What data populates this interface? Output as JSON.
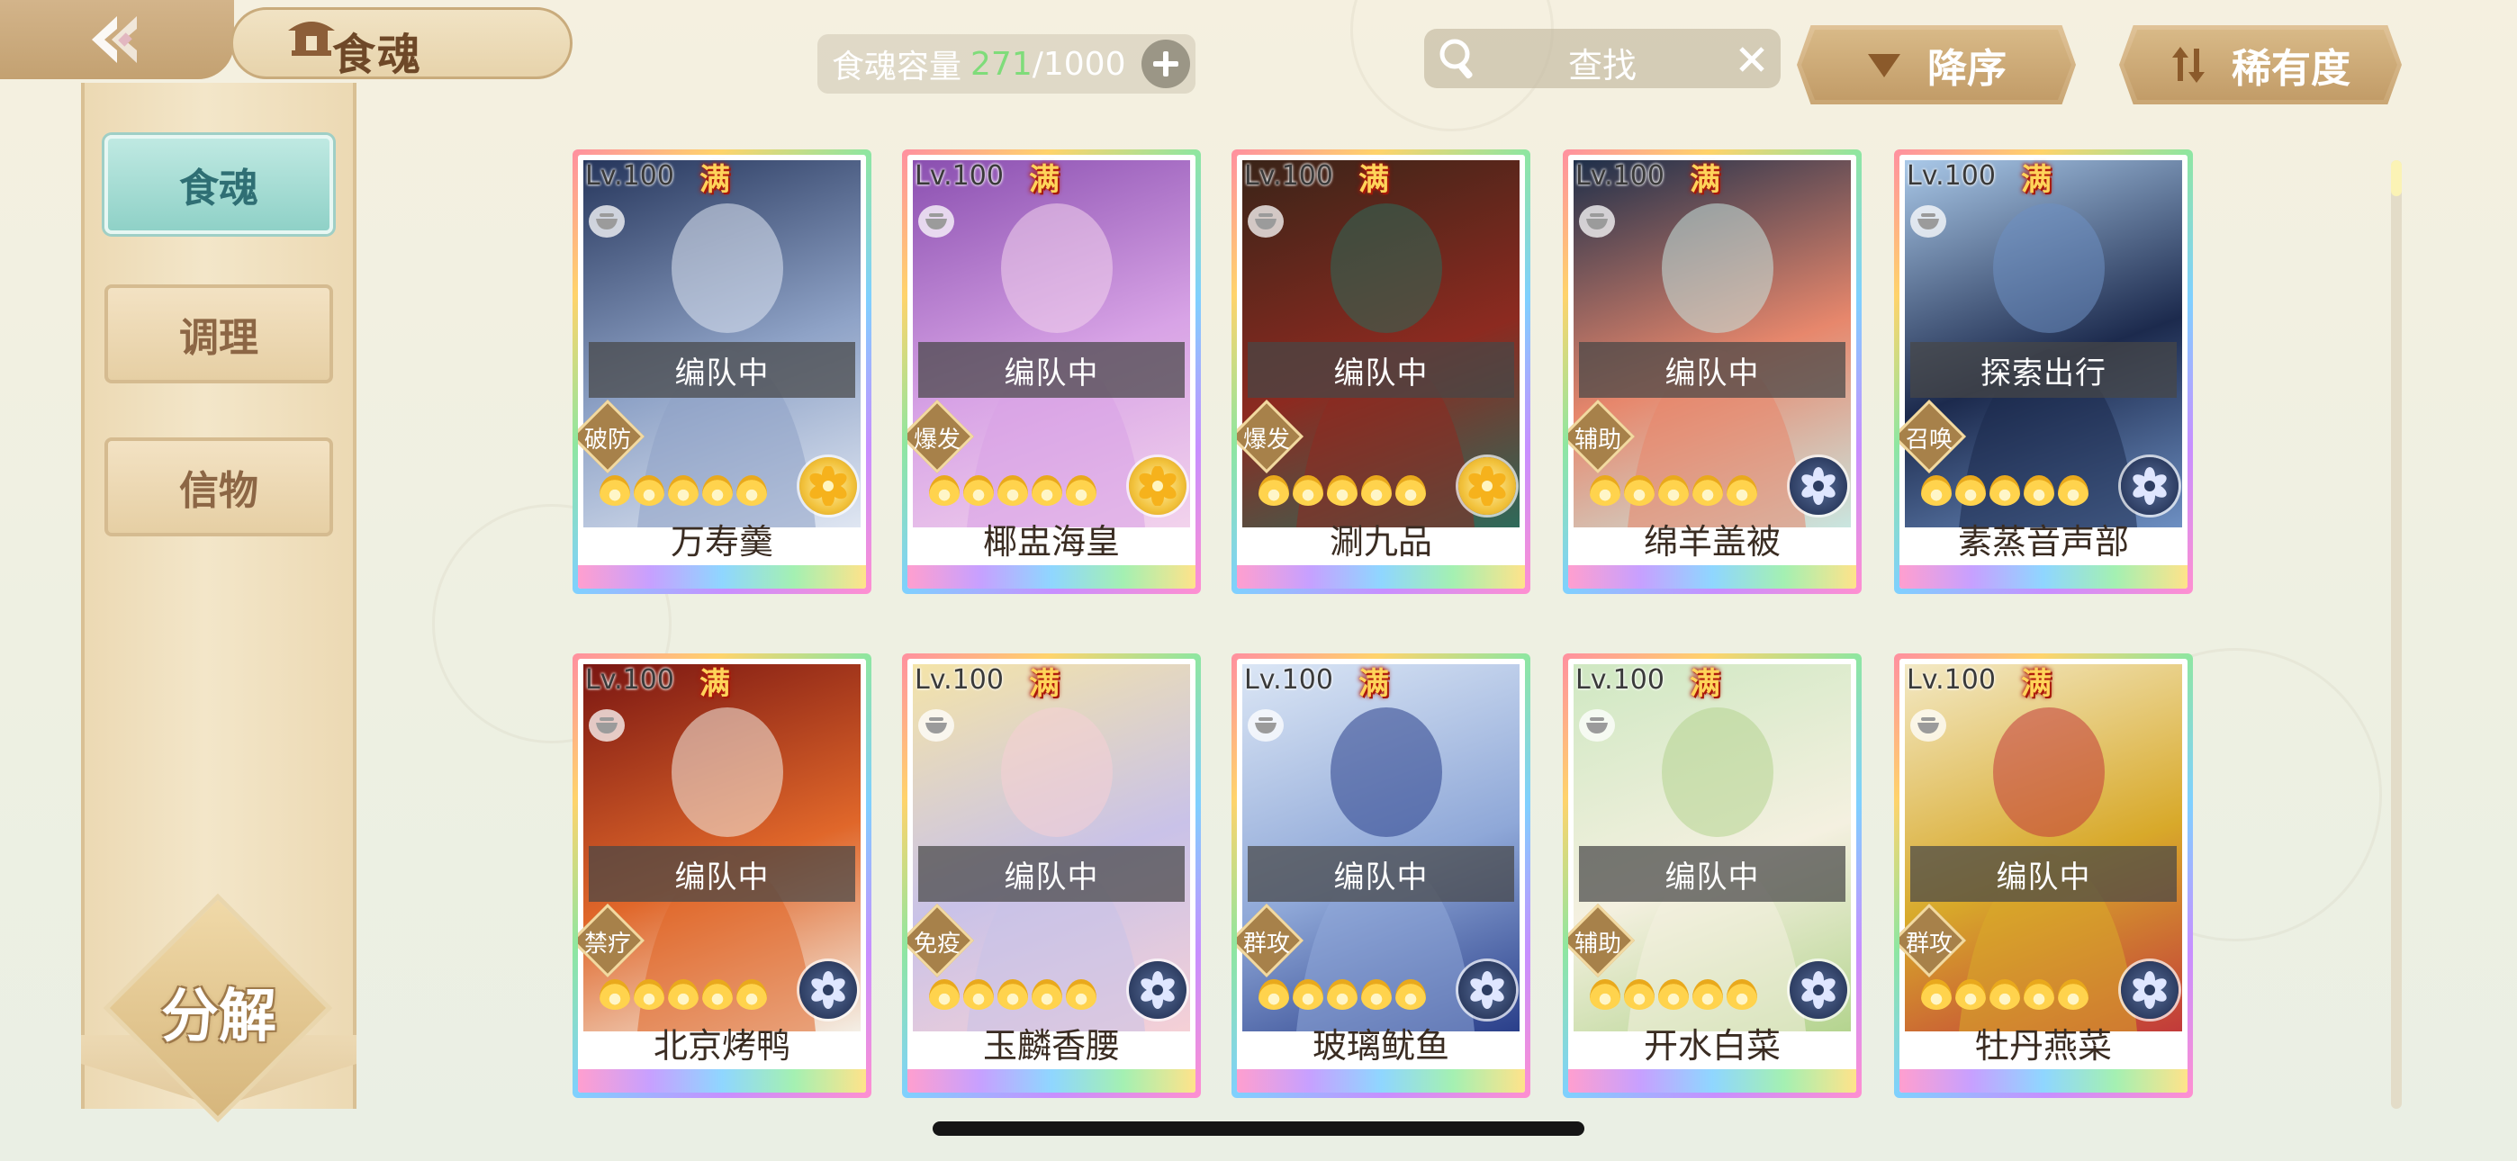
{
  "header": {
    "title": "食魂",
    "back_icon": "back-arrow-icon",
    "home_icon": "pavilion-icon"
  },
  "capacity": {
    "label": "食魂容量",
    "used": "271",
    "separator": "/",
    "total": "1000",
    "used_color": "#7fdc7a"
  },
  "search": {
    "label": "查找"
  },
  "sort": {
    "order_label": "降序",
    "rarity_label": "稀有度"
  },
  "sidebar": {
    "items": [
      {
        "label": "食魂",
        "active": true
      },
      {
        "label": "调理",
        "active": false
      },
      {
        "label": "信物",
        "active": false
      }
    ],
    "decompose_label": "分解"
  },
  "cards": [
    {
      "level": "Lv.100",
      "full": "满",
      "status": "编队中",
      "role": "破防",
      "stars": 5,
      "badge": "gold",
      "name": "万寿羹",
      "palette": [
        "#26365c",
        "#8fa3c7",
        "#dfe6f2"
      ]
    },
    {
      "level": "Lv.100",
      "full": "满",
      "status": "编队中",
      "role": "爆发",
      "stars": 5,
      "badge": "gold",
      "name": "椰盅海皇",
      "palette": [
        "#8a4fb0",
        "#d8a3e6",
        "#f2d3ec"
      ]
    },
    {
      "level": "Lv.100",
      "full": "满",
      "status": "编队中",
      "role": "爆发",
      "stars": 5,
      "badge": "gold",
      "name": "涮九品",
      "palette": [
        "#3a2418",
        "#8c2a20",
        "#2e6a5a"
      ]
    },
    {
      "level": "Lv.100",
      "full": "满",
      "status": "编队中",
      "role": "辅助",
      "stars": 5,
      "badge": "navy",
      "name": "绵羊盖被",
      "palette": [
        "#1e2f4a",
        "#e7876c",
        "#c9e6e0"
      ]
    },
    {
      "level": "Lv.100",
      "full": "满",
      "status": "探索出行",
      "role": "召唤",
      "stars": 5,
      "badge": "navy",
      "name": "素蒸音声部",
      "palette": [
        "#a9c8e8",
        "#1c2a4d",
        "#6d8fc2"
      ]
    },
    {
      "level": "Lv.100",
      "full": "满",
      "status": "编队中",
      "role": "禁疗",
      "stars": 5,
      "badge": "navy",
      "name": "北京烤鸭",
      "palette": [
        "#7a1612",
        "#e0672a",
        "#f4efe6"
      ]
    },
    {
      "level": "Lv.100",
      "full": "满",
      "status": "编队中",
      "role": "免疫",
      "stars": 5,
      "badge": "navy",
      "name": "玉麟香腰",
      "palette": [
        "#f4e4a8",
        "#c9c2e8",
        "#f5d0d6"
      ]
    },
    {
      "level": "Lv.100",
      "full": "满",
      "status": "编队中",
      "role": "群攻",
      "stars": 5,
      "badge": "navy",
      "name": "玻璃鱿鱼",
      "palette": [
        "#dbe6f5",
        "#8fa8d8",
        "#2a3f8a"
      ]
    },
    {
      "level": "Lv.100",
      "full": "满",
      "status": "编队中",
      "role": "辅助",
      "stars": 5,
      "badge": "navy",
      "name": "开水白菜",
      "palette": [
        "#cfe8c2",
        "#f4f0e0",
        "#b4d48f"
      ]
    },
    {
      "level": "Lv.100",
      "full": "满",
      "status": "编队中",
      "role": "群攻",
      "stars": 5,
      "badge": "navy",
      "name": "牡丹燕菜",
      "palette": [
        "#f3e9c5",
        "#d8a92a",
        "#c23a3a"
      ]
    }
  ]
}
